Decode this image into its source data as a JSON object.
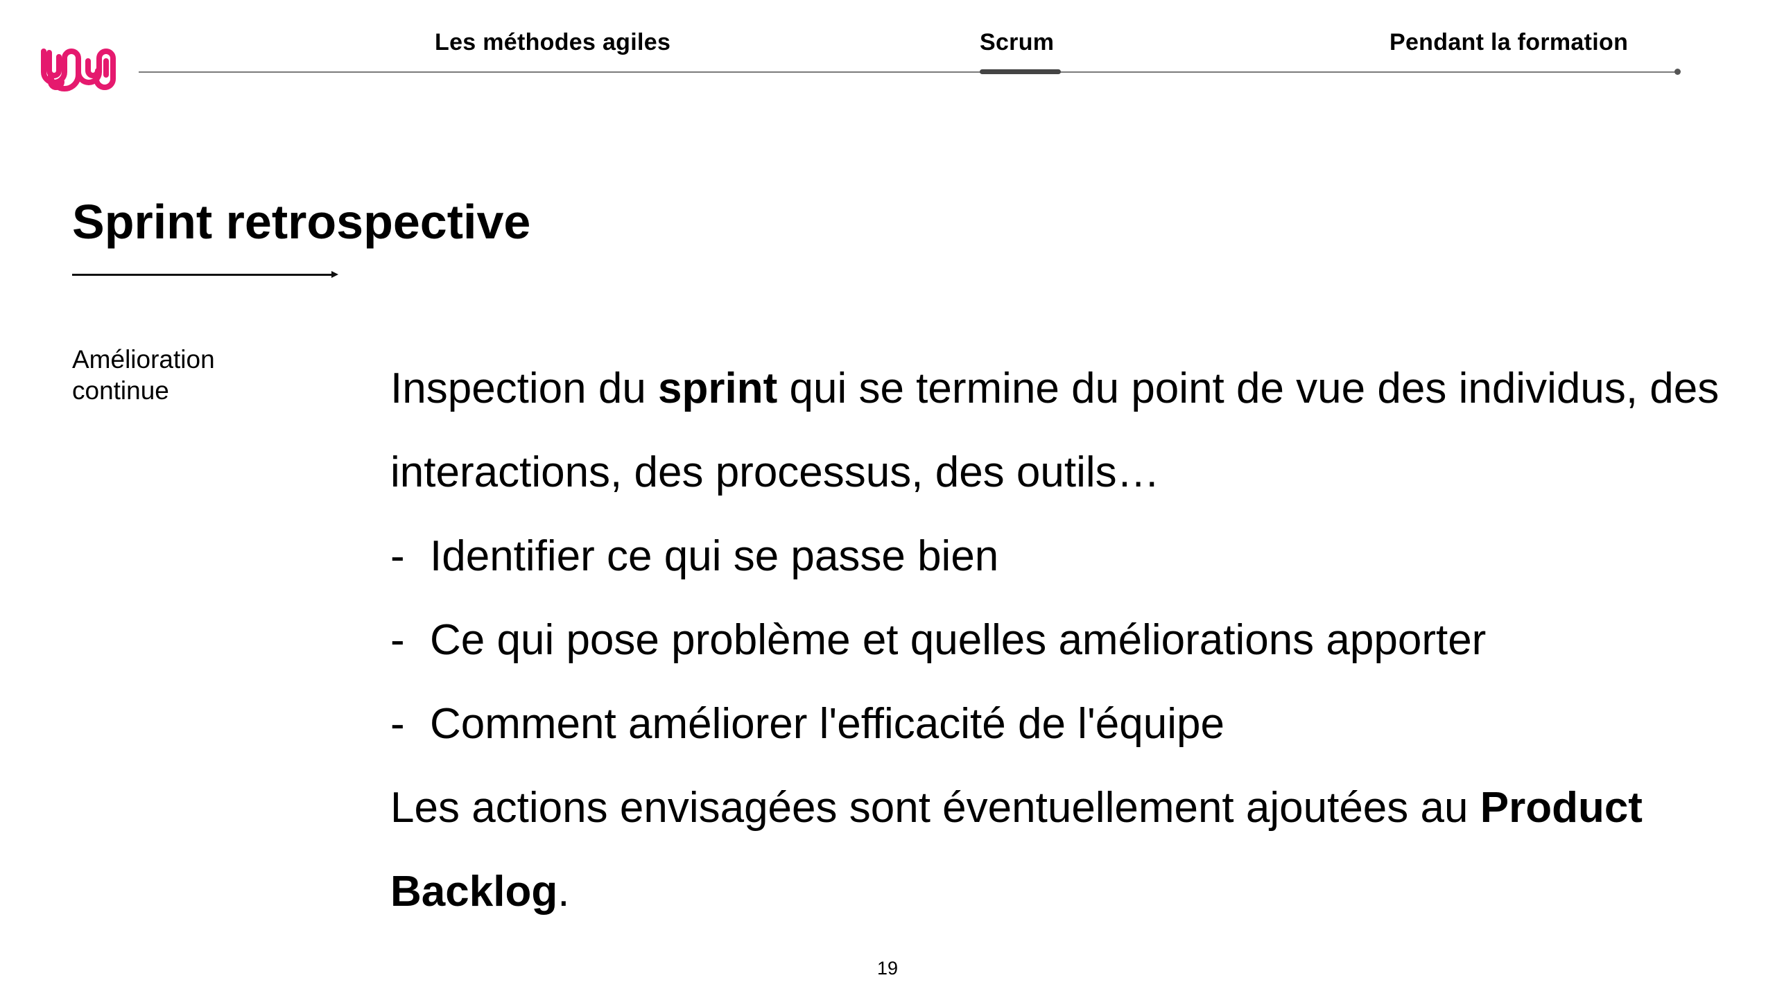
{
  "brand": {
    "logo_icon": "brand-logo-icon",
    "accent_color": "#e5196e"
  },
  "nav": {
    "tabs": [
      {
        "label": "Les méthodes agiles"
      },
      {
        "label": "Scrum",
        "active": true
      },
      {
        "label": "Pendant la formation"
      }
    ]
  },
  "slide": {
    "title": "Sprint retrospective",
    "sidebar_label": "Amélioration continue",
    "intro": {
      "before": "Inspection du ",
      "bold": "sprint",
      "after": " qui se termine du point de vue des individus, des interactions, des processus, des outils…"
    },
    "bullet_marker": "-",
    "bullets": [
      "Identifier ce qui se passe bien",
      "Ce qui pose problème et quelles améliorations apporter",
      "Comment améliorer l'efficacité de l'équipe"
    ],
    "outro": {
      "before": "Les actions envisagées sont éventuellement ajoutées au ",
      "bold": "Product Backlog",
      "after": "."
    },
    "page_number": "19"
  }
}
